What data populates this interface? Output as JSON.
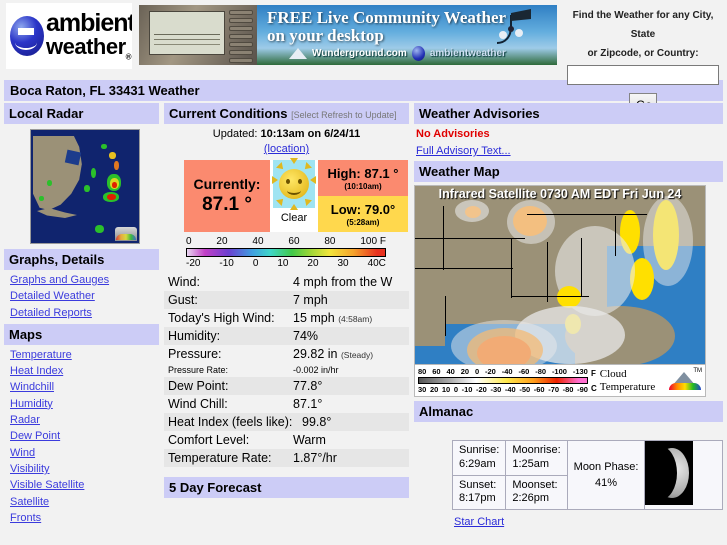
{
  "header": {
    "logo_line1": "ambient",
    "logo_line2": "weather",
    "logo_reg": "®",
    "ad_line1": "FREE Live Community Weather",
    "ad_line2": "on your desktop",
    "ad_brand1": "Wunderground.com",
    "ad_brand2": "ambientweather",
    "search_title_line1": "Find the Weather for any City, State",
    "search_title_line2": "or Zipcode, or Country:",
    "search_value": "",
    "search_placeholder": "",
    "go_label": "Go"
  },
  "page_title": "Boca Raton, FL 33431 Weather",
  "left": {
    "radar_heading": "Local Radar",
    "graphs_heading": "Graphs, Details",
    "graph_links": [
      "Graphs and Gauges",
      "Detailed Weather",
      "Detailed Reports"
    ],
    "maps_heading": "Maps",
    "map_links": [
      "Temperature",
      "Heat Index",
      "Windchill",
      "Humidity",
      "Radar",
      "Dew Point",
      "Wind",
      "Visibility",
      "Visible Satellite",
      "Satellite",
      "Fronts"
    ]
  },
  "current": {
    "heading": "Current Conditions",
    "heading_note": "[Select Refresh to Update]",
    "updated_label": "Updated:",
    "updated_value": "10:13am on 6/24/11",
    "location_link": "(location)",
    "now_label": "Currently:",
    "now_value": "87.1 °",
    "condition": "Clear",
    "high_label": "High: 87.1 °",
    "high_time": "(10:10am)",
    "low_label": "Low: 79.0°",
    "low_time": "(5:28am)",
    "scale_f": [
      "0",
      "20",
      "40",
      "60",
      "80",
      "100 F"
    ],
    "scale_c": [
      "-20",
      "-10",
      "0",
      "10",
      "20",
      "30",
      "40C"
    ],
    "rows": [
      {
        "key": "Wind:",
        "value": "4 mph from the W",
        "note": ""
      },
      {
        "key": "Gust:",
        "value": "7 mph",
        "note": ""
      },
      {
        "key": "Today's High Wind:",
        "value": "15 mph",
        "note": "(4:58am)"
      },
      {
        "key": "Humidity:",
        "value": "74%",
        "note": ""
      },
      {
        "key": "Pressure:",
        "value": "29.82 in",
        "note": "(Steady)"
      },
      {
        "key": "Pressure Rate:",
        "value": "-0.002 in/hr",
        "note": "",
        "small": true
      },
      {
        "key": "Dew Point:",
        "value": "77.8°",
        "note": ""
      },
      {
        "key": "Wind Chill:",
        "value": "87.1°",
        "note": ""
      },
      {
        "key": "Heat Index (feels like):",
        "value": "99.8°",
        "note": ""
      },
      {
        "key": "Comfort Level:",
        "value": "Warm",
        "note": ""
      },
      {
        "key": "Temperature Rate:",
        "value": "1.87°/hr",
        "note": ""
      }
    ],
    "forecast_heading": "5 Day Forecast"
  },
  "right": {
    "advisories_heading": "Weather Advisories",
    "no_advisories": "No Advisories",
    "full_advisory_link": "Full Advisory Text...",
    "map_heading": "Weather Map",
    "map_title": "Infrared Satellite 0730 AM EDT Fri Jun 24",
    "legend_top": [
      "80",
      "60",
      "40",
      "20",
      "0",
      "-20",
      "-40",
      "-60",
      "-80",
      "-100",
      "-130"
    ],
    "legend_bottom": [
      "30",
      "20",
      "10",
      "0",
      "-10",
      "-20",
      "-30",
      "-40",
      "-50",
      "-60",
      "-70",
      "-80",
      "-90"
    ],
    "legend_unit_f": "F",
    "legend_unit_c": "C",
    "legend_caption_line1": "Cloud",
    "legend_caption_line2": "Temperature",
    "almanac_heading": "Almanac",
    "sunrise_label": "Sunrise:",
    "sunrise_value": "6:29am",
    "sunset_label": "Sunset:",
    "sunset_value": "8:17pm",
    "moonrise_label": "Moonrise:",
    "moonrise_value": "1:25am",
    "moonset_label": "Moonset:",
    "moonset_value": "2:26pm",
    "moon_phase_label": "Moon Phase:",
    "moon_phase_value": "41%",
    "star_chart_link": "Star Chart"
  },
  "colors": {
    "bar": "#ccccf6",
    "hot": "#fb8a6f",
    "warm": "#ffd84d",
    "link": "#3b3bdd",
    "alert": "#e00000"
  }
}
